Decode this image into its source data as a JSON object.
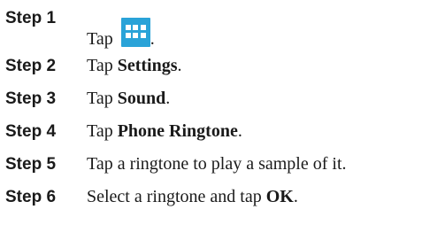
{
  "steps": [
    {
      "label": "Step 1",
      "prefix": "Tap ",
      "icon": "apps-grid-icon",
      "suffix": "."
    },
    {
      "label": "Step 2",
      "prefix": "Tap ",
      "bold": "Settings",
      "suffix": "."
    },
    {
      "label": "Step 3",
      "prefix": "Tap ",
      "bold": "Sound",
      "suffix": "."
    },
    {
      "label": "Step 4",
      "prefix": "Tap ",
      "bold": "Phone Ringtone",
      "suffix": "."
    },
    {
      "label": "Step 5",
      "text": "Tap a ringtone to play a sample of it."
    },
    {
      "label": "Step 6",
      "prefix": "Select a ringtone and tap ",
      "bold": "OK",
      "suffix": "."
    }
  ],
  "colors": {
    "icon_background": "#2aa3d8",
    "text": "#1a1a1a"
  }
}
